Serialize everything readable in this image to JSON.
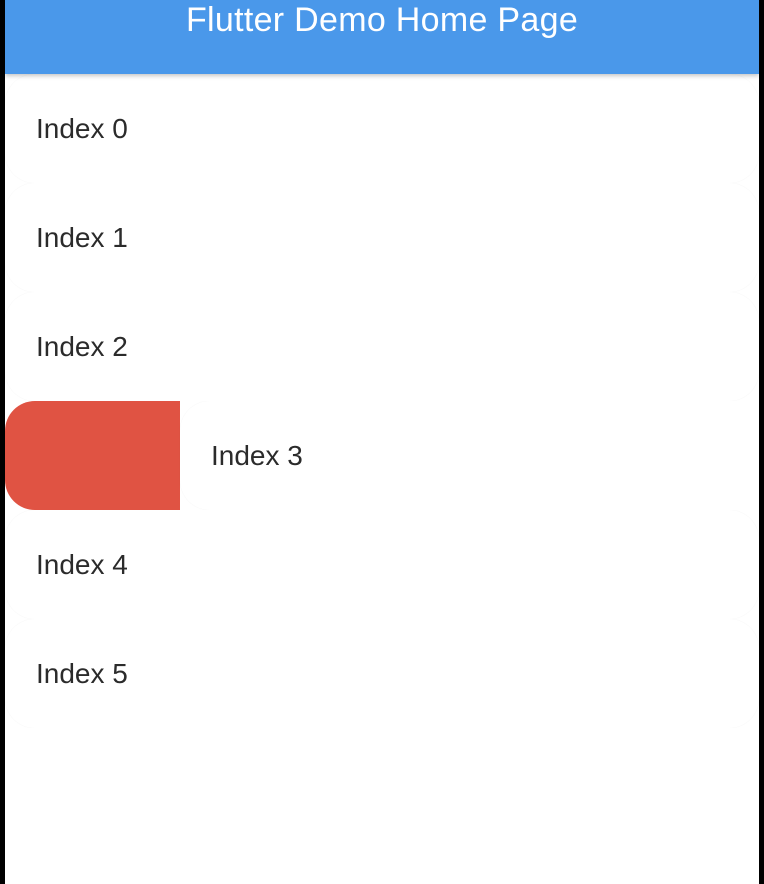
{
  "app_bar": {
    "title": "Flutter Demo Home Page",
    "color": "#4a98ea"
  },
  "list": {
    "items": [
      {
        "label": "Index 0"
      },
      {
        "label": "Index 1"
      },
      {
        "label": "Index 2"
      },
      {
        "label": "Index 3",
        "swiped": true,
        "dismiss_background_color": "#e05343"
      },
      {
        "label": "Index 4"
      },
      {
        "label": "Index 5"
      }
    ]
  }
}
